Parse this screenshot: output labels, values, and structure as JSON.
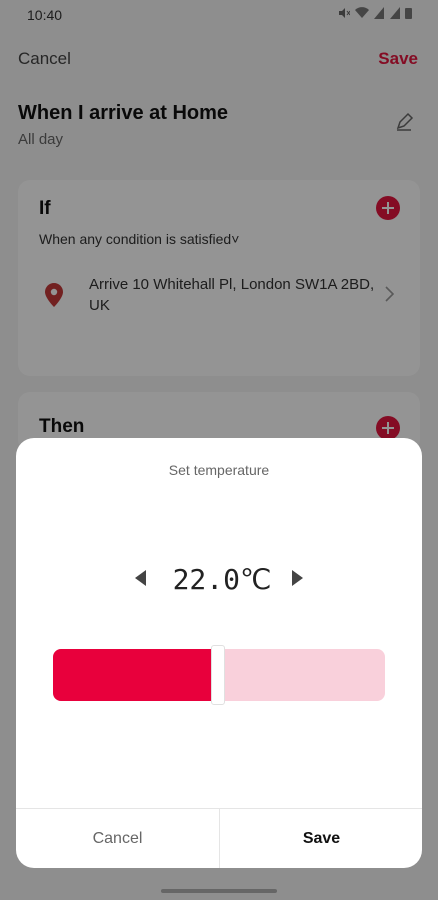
{
  "status_bar": {
    "time": "10:40",
    "icons": [
      "mute-icon",
      "wifi-icon",
      "signal-icon",
      "signal-icon",
      "battery-icon"
    ]
  },
  "header": {
    "cancel_label": "Cancel",
    "save_label": "Save"
  },
  "scene": {
    "title": "When I arrive at Home",
    "subtitle": "All day"
  },
  "if_card": {
    "title": "If",
    "condition_mode": "When any condition is satisfied˅",
    "condition": {
      "text": "Arrive 10 Whitehall Pl, London SW1A 2BD, UK"
    }
  },
  "then_card": {
    "title": "Then"
  },
  "dialog": {
    "title": "Set temperature",
    "temperature": "22.0℃",
    "slider_level": 0.48,
    "cancel_label": "Cancel",
    "save_label": "Save"
  },
  "colors": {
    "accent": "#e3163f",
    "slider_fill": "#e8003c",
    "slider_track": "#f9d0db"
  }
}
